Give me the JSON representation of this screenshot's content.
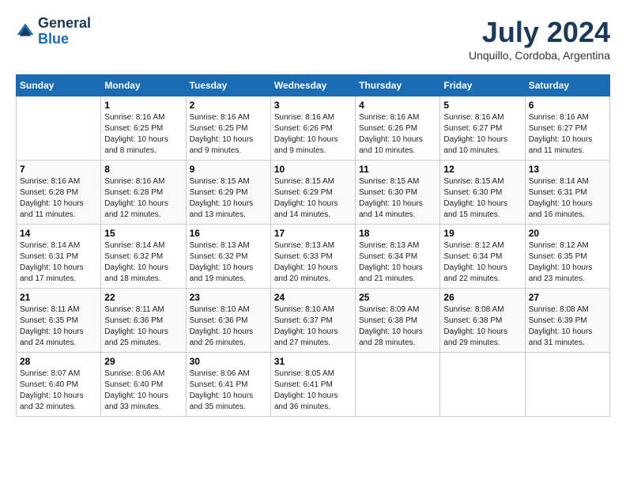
{
  "header": {
    "logo_line1": "General",
    "logo_line2": "Blue",
    "month_year": "July 2024",
    "location": "Unquillo, Cordoba, Argentina"
  },
  "days_of_week": [
    "Sunday",
    "Monday",
    "Tuesday",
    "Wednesday",
    "Thursday",
    "Friday",
    "Saturday"
  ],
  "weeks": [
    [
      {
        "day": "",
        "info": ""
      },
      {
        "day": "1",
        "info": "Sunrise: 8:16 AM\nSunset: 6:25 PM\nDaylight: 10 hours\nand 8 minutes."
      },
      {
        "day": "2",
        "info": "Sunrise: 8:16 AM\nSunset: 6:25 PM\nDaylight: 10 hours\nand 9 minutes."
      },
      {
        "day": "3",
        "info": "Sunrise: 8:16 AM\nSunset: 6:26 PM\nDaylight: 10 hours\nand 9 minutes."
      },
      {
        "day": "4",
        "info": "Sunrise: 8:16 AM\nSunset: 6:26 PM\nDaylight: 10 hours\nand 10 minutes."
      },
      {
        "day": "5",
        "info": "Sunrise: 8:16 AM\nSunset: 6:27 PM\nDaylight: 10 hours\nand 10 minutes."
      },
      {
        "day": "6",
        "info": "Sunrise: 8:16 AM\nSunset: 6:27 PM\nDaylight: 10 hours\nand 11 minutes."
      }
    ],
    [
      {
        "day": "7",
        "info": ""
      },
      {
        "day": "8",
        "info": "Sunrise: 8:16 AM\nSunset: 6:28 PM\nDaylight: 10 hours\nand 12 minutes."
      },
      {
        "day": "9",
        "info": "Sunrise: 8:15 AM\nSunset: 6:29 PM\nDaylight: 10 hours\nand 13 minutes."
      },
      {
        "day": "10",
        "info": "Sunrise: 8:15 AM\nSunset: 6:29 PM\nDaylight: 10 hours\nand 14 minutes."
      },
      {
        "day": "11",
        "info": "Sunrise: 8:15 AM\nSunset: 6:30 PM\nDaylight: 10 hours\nand 14 minutes."
      },
      {
        "day": "12",
        "info": "Sunrise: 8:15 AM\nSunset: 6:30 PM\nDaylight: 10 hours\nand 15 minutes."
      },
      {
        "day": "13",
        "info": "Sunrise: 8:14 AM\nSunset: 6:31 PM\nDaylight: 10 hours\nand 16 minutes."
      }
    ],
    [
      {
        "day": "14",
        "info": ""
      },
      {
        "day": "15",
        "info": "Sunrise: 8:14 AM\nSunset: 6:32 PM\nDaylight: 10 hours\nand 18 minutes."
      },
      {
        "day": "16",
        "info": "Sunrise: 8:13 AM\nSunset: 6:32 PM\nDaylight: 10 hours\nand 19 minutes."
      },
      {
        "day": "17",
        "info": "Sunrise: 8:13 AM\nSunset: 6:33 PM\nDaylight: 10 hours\nand 20 minutes."
      },
      {
        "day": "18",
        "info": "Sunrise: 8:13 AM\nSunset: 6:34 PM\nDaylight: 10 hours\nand 21 minutes."
      },
      {
        "day": "19",
        "info": "Sunrise: 8:12 AM\nSunset: 6:34 PM\nDaylight: 10 hours\nand 22 minutes."
      },
      {
        "day": "20",
        "info": "Sunrise: 8:12 AM\nSunset: 6:35 PM\nDaylight: 10 hours\nand 23 minutes."
      }
    ],
    [
      {
        "day": "21",
        "info": ""
      },
      {
        "day": "22",
        "info": "Sunrise: 8:11 AM\nSunset: 6:36 PM\nDaylight: 10 hours\nand 25 minutes."
      },
      {
        "day": "23",
        "info": "Sunrise: 8:10 AM\nSunset: 6:36 PM\nDaylight: 10 hours\nand 26 minutes."
      },
      {
        "day": "24",
        "info": "Sunrise: 8:10 AM\nSunset: 6:37 PM\nDaylight: 10 hours\nand 27 minutes."
      },
      {
        "day": "25",
        "info": "Sunrise: 8:09 AM\nSunset: 6:38 PM\nDaylight: 10 hours\nand 28 minutes."
      },
      {
        "day": "26",
        "info": "Sunrise: 8:08 AM\nSunset: 6:38 PM\nDaylight: 10 hours\nand 29 minutes."
      },
      {
        "day": "27",
        "info": "Sunrise: 8:08 AM\nSunset: 6:39 PM\nDaylight: 10 hours\nand 31 minutes."
      }
    ],
    [
      {
        "day": "28",
        "info": "Sunrise: 8:07 AM\nSunset: 6:40 PM\nDaylight: 10 hours\nand 32 minutes."
      },
      {
        "day": "29",
        "info": "Sunrise: 8:06 AM\nSunset: 6:40 PM\nDaylight: 10 hours\nand 33 minutes."
      },
      {
        "day": "30",
        "info": "Sunrise: 8:06 AM\nSunset: 6:41 PM\nDaylight: 10 hours\nand 35 minutes."
      },
      {
        "day": "31",
        "info": "Sunrise: 8:05 AM\nSunset: 6:41 PM\nDaylight: 10 hours\nand 36 minutes."
      },
      {
        "day": "",
        "info": ""
      },
      {
        "day": "",
        "info": ""
      },
      {
        "day": "",
        "info": ""
      }
    ]
  ],
  "week7_sunday": "Sunrise: 8:16 AM\nSunset: 6:28 PM\nDaylight: 10 hours\nand 11 minutes.",
  "week3_sunday": "Sunrise: 8:14 AM\nSunset: 6:31 PM\nDaylight: 10 hours\nand 17 minutes.",
  "week4_sunday": "Sunrise: 8:11 AM\nSunset: 6:35 PM\nDaylight: 10 hours\nand 24 minutes."
}
